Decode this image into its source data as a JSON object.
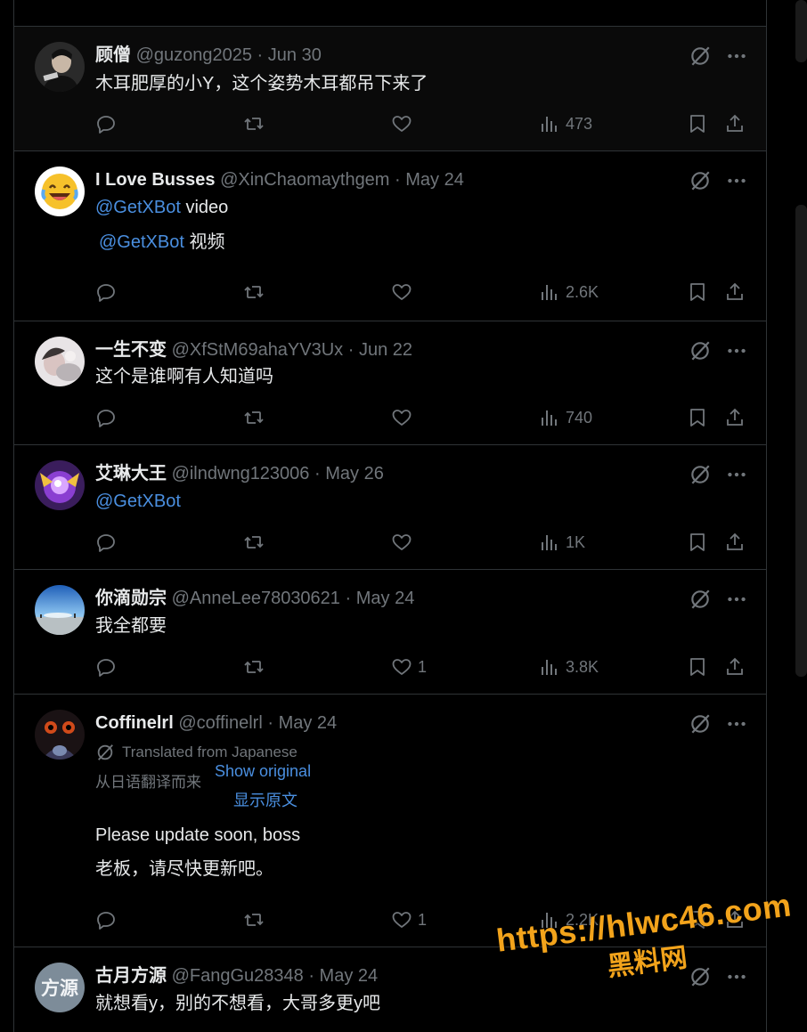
{
  "tweets": [
    {
      "name": "顾僧",
      "handle": "@guzong2025",
      "date": "Jun 30",
      "avatar": "dark-portrait-avatar",
      "lines": [
        "木耳肥厚的小Y，这个姿势木耳都吊下来了"
      ],
      "stats": {
        "replies": "",
        "reposts": "",
        "likes": "",
        "views": "473"
      }
    },
    {
      "name": "I Love Busses",
      "handle": "@XinChaomaythgem",
      "date": "May 24",
      "avatar": "laughing-emoji-avatar",
      "mention": "@GetXBot",
      "text_after_mention": "video",
      "translation_mention": "@GetXBot",
      "translation_text": "视频",
      "stats": {
        "replies": "",
        "reposts": "",
        "likes": "",
        "views": "2.6K"
      }
    },
    {
      "name": "一生不变",
      "handle": "@XfStM69ahaYV3Ux",
      "date": "Jun 22",
      "avatar": "photo-avatar",
      "lines": [
        "这个是谁啊有人知道吗"
      ],
      "stats": {
        "replies": "",
        "reposts": "",
        "likes": "",
        "views": "740"
      }
    },
    {
      "name": "艾琳大王",
      "handle": "@ilndwng123006",
      "date": "May 26",
      "avatar": "purple-game-avatar",
      "mention": "@GetXBot",
      "stats": {
        "replies": "",
        "reposts": "",
        "likes": "",
        "views": "1K"
      }
    },
    {
      "name": "你滴勋宗",
      "handle": "@AnneLee78030621",
      "date": "May 24",
      "avatar": "sky-landscape-avatar",
      "lines": [
        "我全都要"
      ],
      "stats": {
        "replies": "",
        "reposts": "",
        "likes": "1",
        "views": "3.8K"
      }
    },
    {
      "name": "Coffinelrl",
      "handle": "@coffinelrl",
      "date": "May 24",
      "avatar": "dark-eyes-avatar",
      "translated_from": "Translated from Japanese",
      "translated_from_cn": "从日语翻译而来",
      "show_original": "Show original",
      "show_original_cn": "显示原文",
      "lines": [
        "Please update soon, boss",
        "老板，请尽快更新吧。"
      ],
      "stats": {
        "replies": "",
        "reposts": "",
        "likes": "1",
        "views": "2.2K"
      }
    },
    {
      "name": "古月方源",
      "handle": "@FangGu28348",
      "date": "May 24",
      "avatar_text": "方源",
      "lines": [
        "就想看y，别的不想看，大哥多更y吧"
      ]
    }
  ],
  "separator": "·",
  "watermark": {
    "url": "https://hlwc46.com",
    "cn": "黑料网"
  },
  "colors": {
    "background": "#000000",
    "text": "#e7e9ea",
    "muted": "#71767b",
    "link": "#4a8fe0",
    "border": "#2f3336",
    "watermark": "#f2a31b"
  },
  "icons": [
    "reply-icon",
    "repost-icon",
    "like-icon",
    "views-icon",
    "bookmark-icon",
    "share-icon",
    "grok-icon",
    "more-icon"
  ]
}
